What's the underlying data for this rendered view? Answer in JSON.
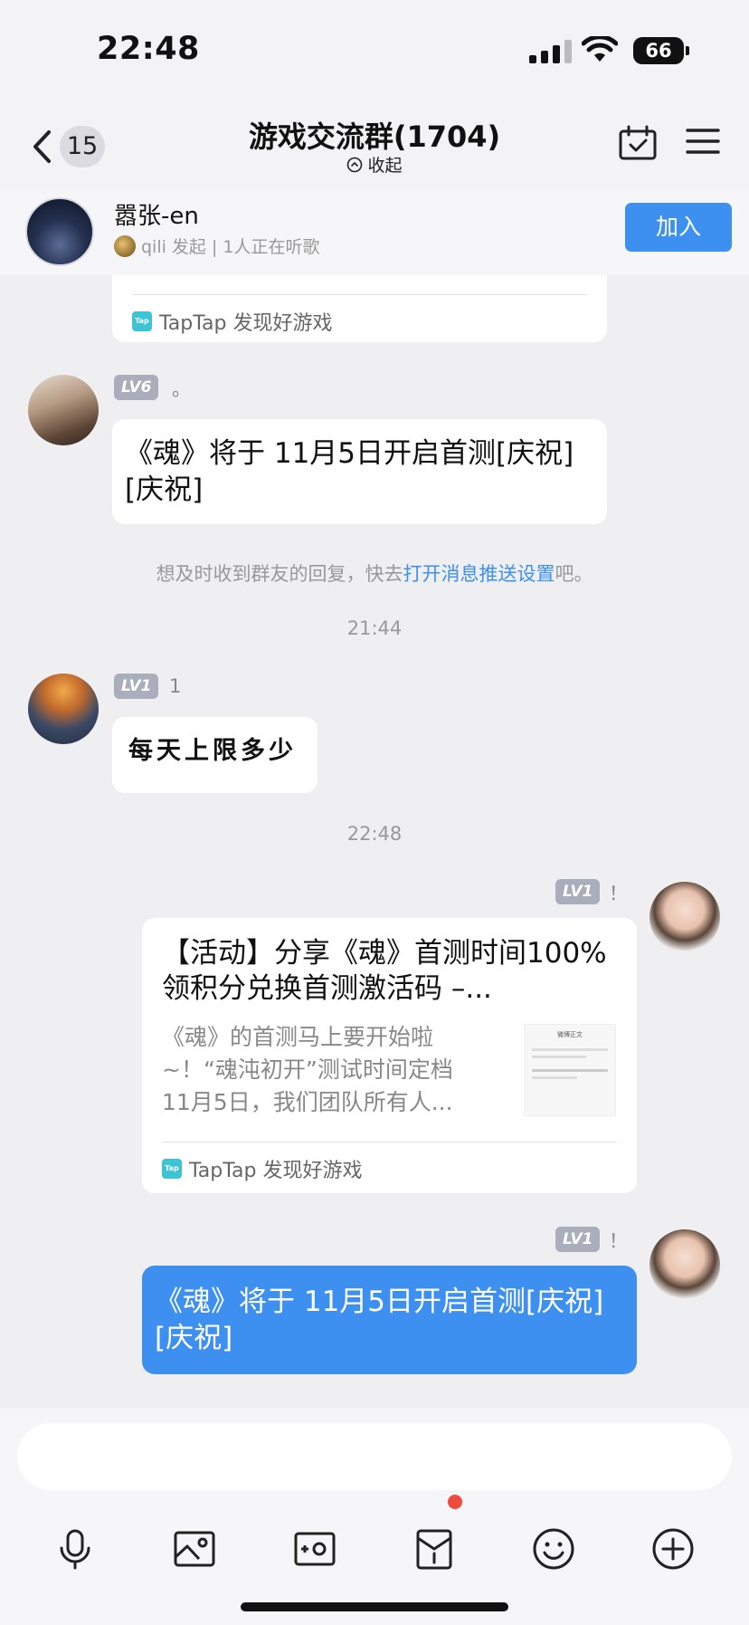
{
  "status_bar": {
    "time": "22:48",
    "battery": "66"
  },
  "nav": {
    "back_count": "15",
    "title": "游戏交流群(1704)",
    "collapse_label": "收起"
  },
  "listen_banner": {
    "name": "嚣张-en",
    "subtitle": "qili 发起 | 1人正在听歌",
    "join_label": "加入"
  },
  "messages": [
    {
      "type": "card_footer_partial",
      "footer": "TapTap 发现好游戏"
    },
    {
      "type": "text",
      "level": "LV6",
      "sender": "。",
      "text": "《魂》将于 11月5日开启首测[庆祝][庆祝]"
    },
    {
      "type": "system_tip",
      "prefix": "想及时收到群友的回复，快去",
      "link": "打开消息推送设置",
      "suffix": "吧。"
    },
    {
      "type": "time",
      "text": "21:44"
    },
    {
      "type": "text",
      "level": "LV1",
      "sender": "1",
      "text": "每天上限多少"
    },
    {
      "type": "time",
      "text": "22:48"
    },
    {
      "type": "card",
      "level": "LV1",
      "sender": "！",
      "title": "【活动】分享《魂》首测时间100%领积分兑换首测激活码 –...",
      "desc": "《魂》的首测马上要开始啦~！“魂沌初开”测试时间定档11月5日，我们团队所有人...",
      "thumb_title": "微博正文",
      "footer": "TapTap 发现好游戏"
    },
    {
      "type": "text_self",
      "level": "LV1",
      "sender": "！",
      "text": "《魂》将于 11月5日开启首测[庆祝][庆祝]"
    }
  ],
  "input": {
    "placeholder": ""
  },
  "toolbar": [
    "microphone-icon",
    "image-icon",
    "camera-icon",
    "red-packet-icon",
    "emoji-icon",
    "plus-icon"
  ],
  "colors": {
    "accent": "#3d8ff0",
    "background": "#efeff2",
    "badge": "#a9adbc"
  }
}
